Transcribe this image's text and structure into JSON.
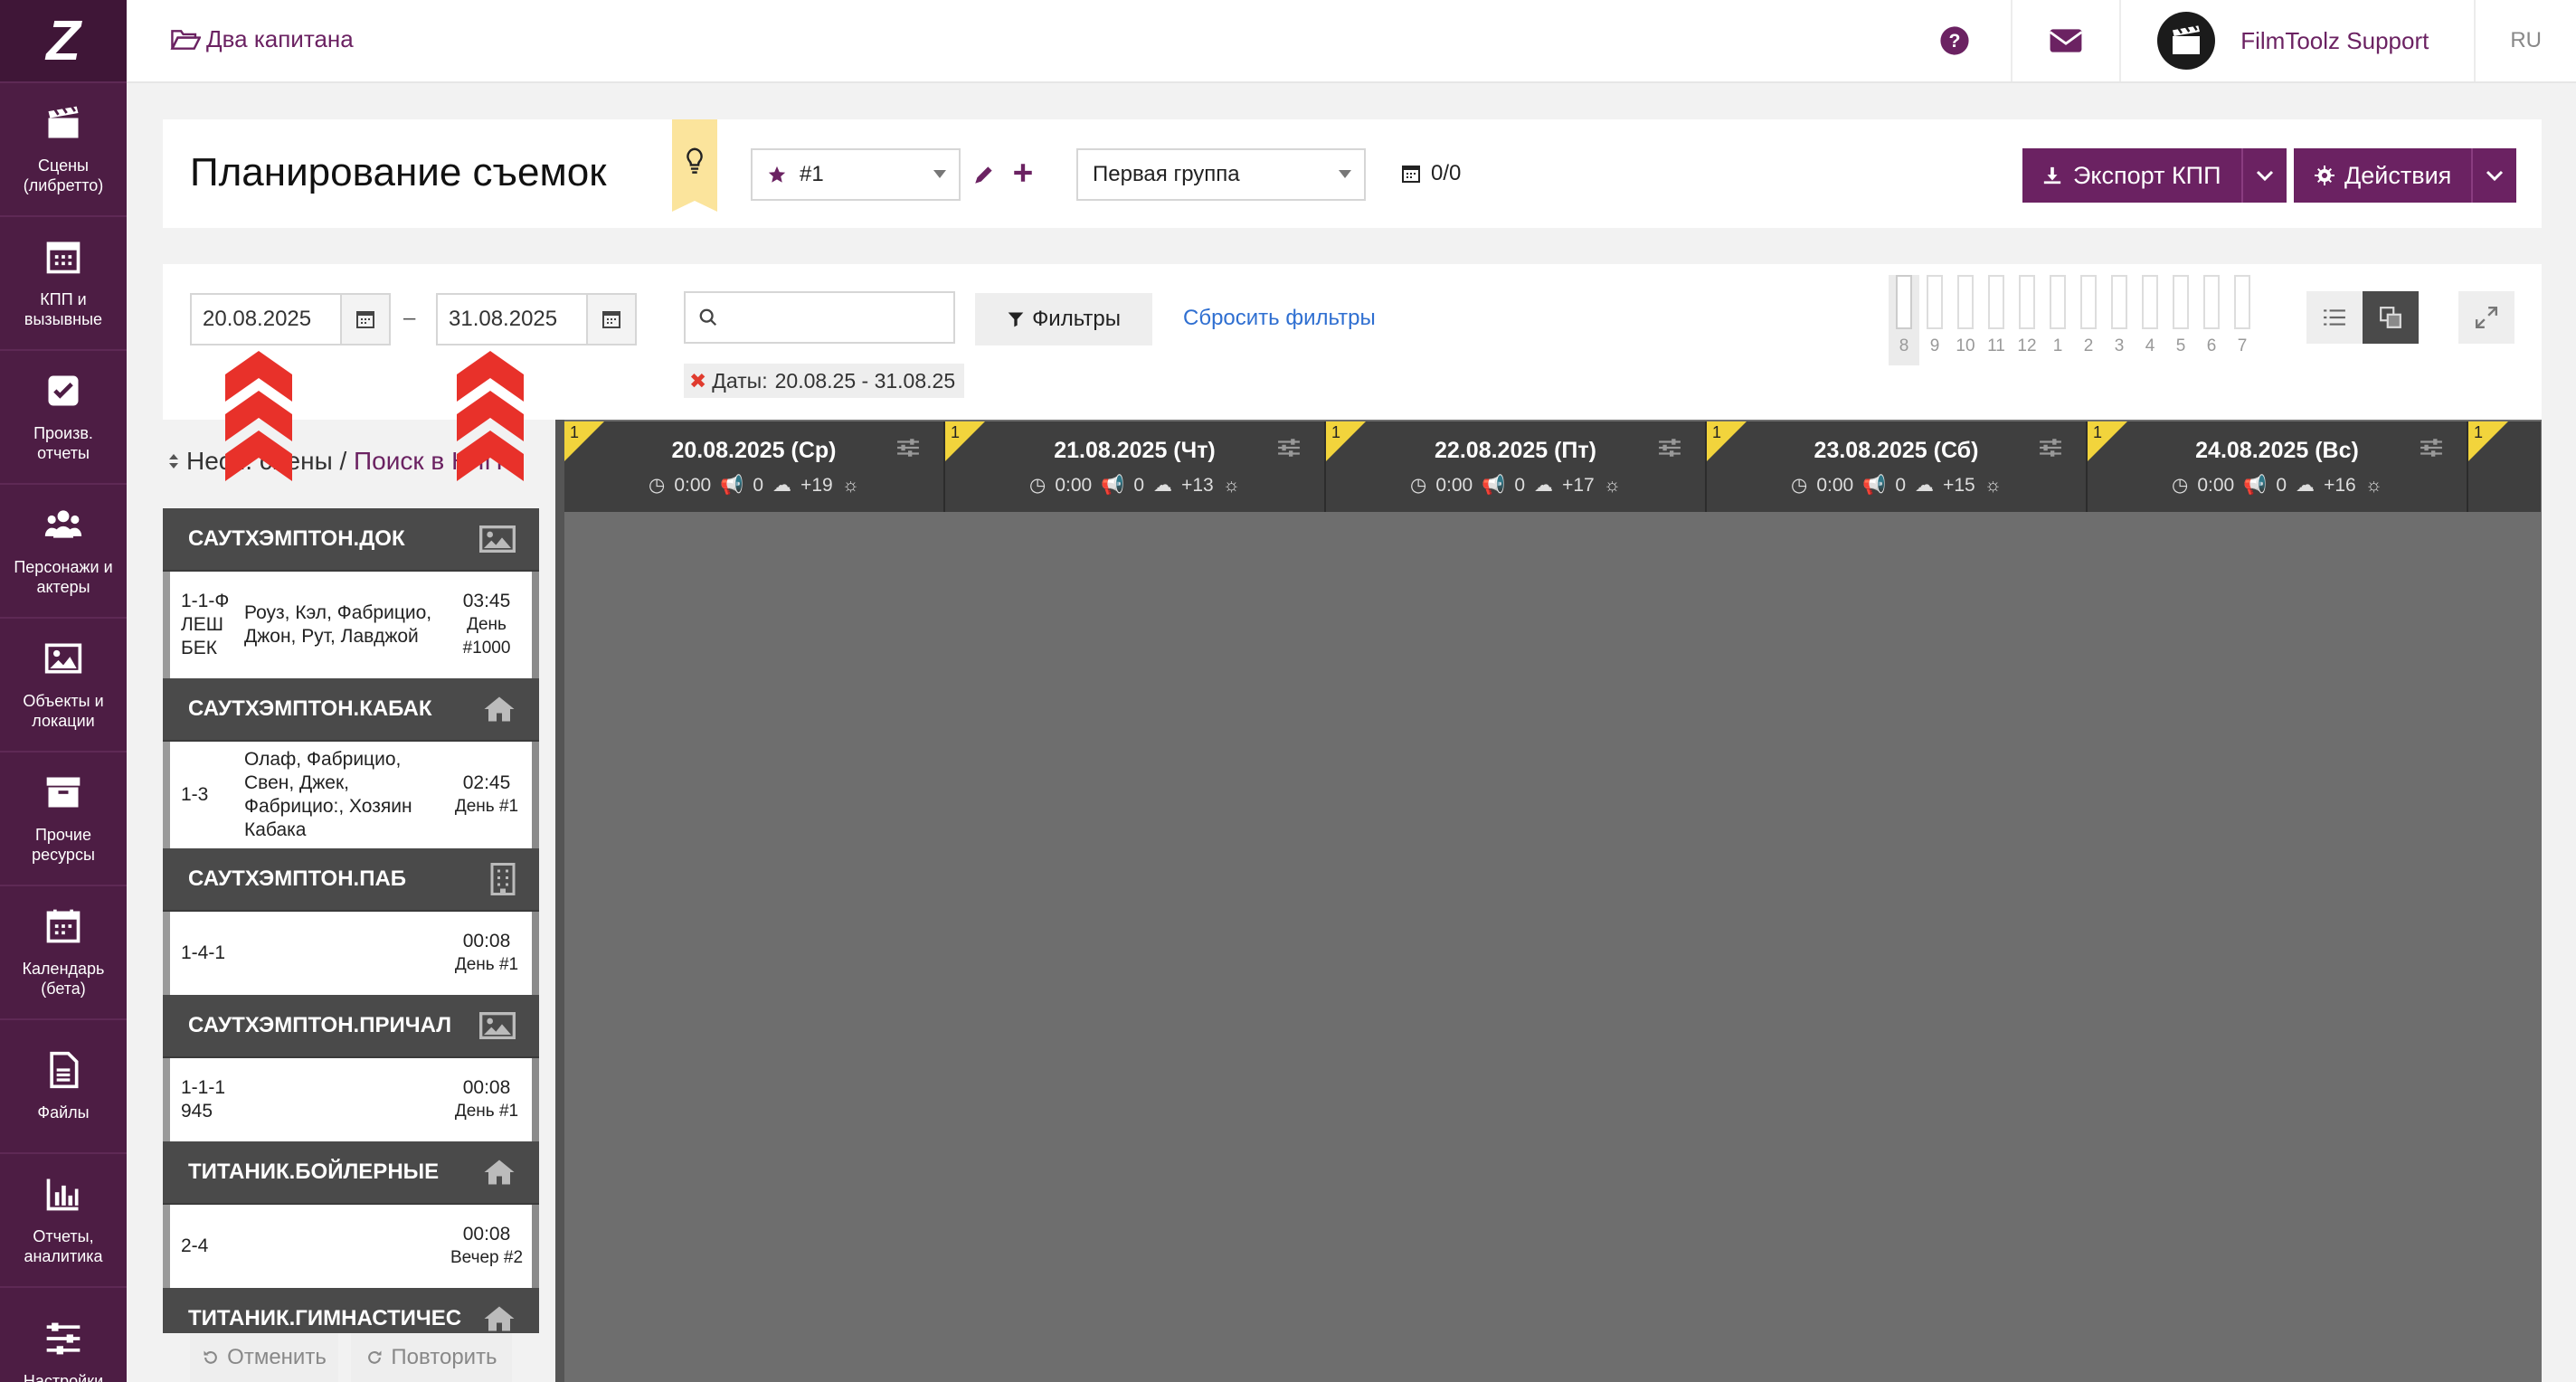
{
  "sidebar": {
    "items": [
      {
        "label": "Сцены (либретто)",
        "icon": "clapperboard-icon"
      },
      {
        "label": "КПП и вызывные",
        "icon": "calendar-grid-icon"
      },
      {
        "label": "Произв. отчеты",
        "icon": "checkbox-icon"
      },
      {
        "label": "Персонажи и актеры",
        "icon": "people-icon"
      },
      {
        "label": "Объекты и локации",
        "icon": "image-icon"
      },
      {
        "label": "Прочие ресурсы",
        "icon": "archive-icon"
      },
      {
        "label": "Календарь (бета)",
        "icon": "calendar-icon"
      },
      {
        "label": "Файлы",
        "icon": "file-icon"
      },
      {
        "label": "Отчеты, аналитика",
        "icon": "bar-chart-icon"
      },
      {
        "label": "Настройки",
        "icon": "sliders-icon"
      }
    ]
  },
  "topbar": {
    "project": "Два капитана",
    "user": "FilmToolz Support",
    "lang": "RU"
  },
  "title_panel": {
    "title": "Планирование съемок",
    "version_select": "#1",
    "group_select": "Первая группа",
    "days_count": "0/0",
    "export_label": "Экспорт КПП",
    "actions_label": "Действия"
  },
  "filters": {
    "date_from": "20.08.2025",
    "date_to": "31.08.2025",
    "date_sep": "–",
    "search_value": "",
    "filters_label": "Фильтры",
    "reset_label": "Сбросить фильтры",
    "chip_label": "Даты:",
    "chip_value": "20.08.25 - 31.08.25",
    "hours": [
      "8",
      "9",
      "10",
      "11",
      "12",
      "1",
      "2",
      "3",
      "4",
      "5",
      "6",
      "7"
    ]
  },
  "unscheduled": {
    "breadcrumb_a": "Несн. сцены",
    "breadcrumb_sep": " / ",
    "breadcrumb_b": "Поиск в КПП",
    "groups": [
      {
        "location": "САУТХЭМПТОН.ДОК",
        "icon": "image-icon",
        "scenes": [
          {
            "num": "1-1-Ф ЛЕШ БЕК",
            "actors": "Роуз, Кэл, Фабрицио, Джон, Рут, Лавджой",
            "time": "03:45",
            "day": "День #1000"
          }
        ]
      },
      {
        "location": "САУТХЭМПТОН.КАБАК",
        "icon": "home-icon",
        "scenes": [
          {
            "num": "1-3",
            "actors": "Олаф, Фабрицио, Свен, Джек, Фабрицио:, Хозяин Кабака",
            "time": "02:45",
            "day": "День #1"
          }
        ]
      },
      {
        "location": "САУТХЭМПТОН.ПАБ",
        "icon": "building-icon",
        "scenes": [
          {
            "num": "1-4-1",
            "actors": "",
            "time": "00:08",
            "day": "День #1"
          }
        ]
      },
      {
        "location": "САУТХЭМПТОН.ПРИЧАЛ",
        "icon": "image-icon",
        "scenes": [
          {
            "num": "1-1-1 945",
            "actors": "",
            "time": "00:08",
            "day": "День #1"
          }
        ]
      },
      {
        "location": "ТИТАНИК.БОЙЛЕРНЫЕ",
        "icon": "home-icon",
        "scenes": [
          {
            "num": "2-4",
            "actors": "",
            "time": "00:08",
            "day": "Вечер #2"
          }
        ]
      },
      {
        "location": "ТИТАНИК.ГИМНАСТИЧЕС",
        "icon": "home-icon",
        "scenes": []
      }
    ],
    "undo_label": "Отменить",
    "redo_label": "Повторить"
  },
  "board": {
    "days": [
      {
        "flag": "1",
        "date": "20.08.2025 (Ср)",
        "time": "0:00",
        "ads": "0",
        "weather": "+19",
        "weather_icon": "rain-cloud-icon"
      },
      {
        "flag": "1",
        "date": "21.08.2025 (Чт)",
        "time": "0:00",
        "ads": "0",
        "weather": "+13",
        "weather_icon": "rain-cloud-icon"
      },
      {
        "flag": "1",
        "date": "22.08.2025 (Пт)",
        "time": "0:00",
        "ads": "0",
        "weather": "+17",
        "weather_icon": "cloud-icon"
      },
      {
        "flag": "1",
        "date": "23.08.2025 (Сб)",
        "time": "0:00",
        "ads": "0",
        "weather": "+15",
        "weather_icon": "rain-cloud-icon"
      },
      {
        "flag": "1",
        "date": "24.08.2025 (Вс)",
        "time": "0:00",
        "ads": "0",
        "weather": "+16",
        "weather_icon": "cloud-icon"
      }
    ],
    "next_flag": "1"
  }
}
